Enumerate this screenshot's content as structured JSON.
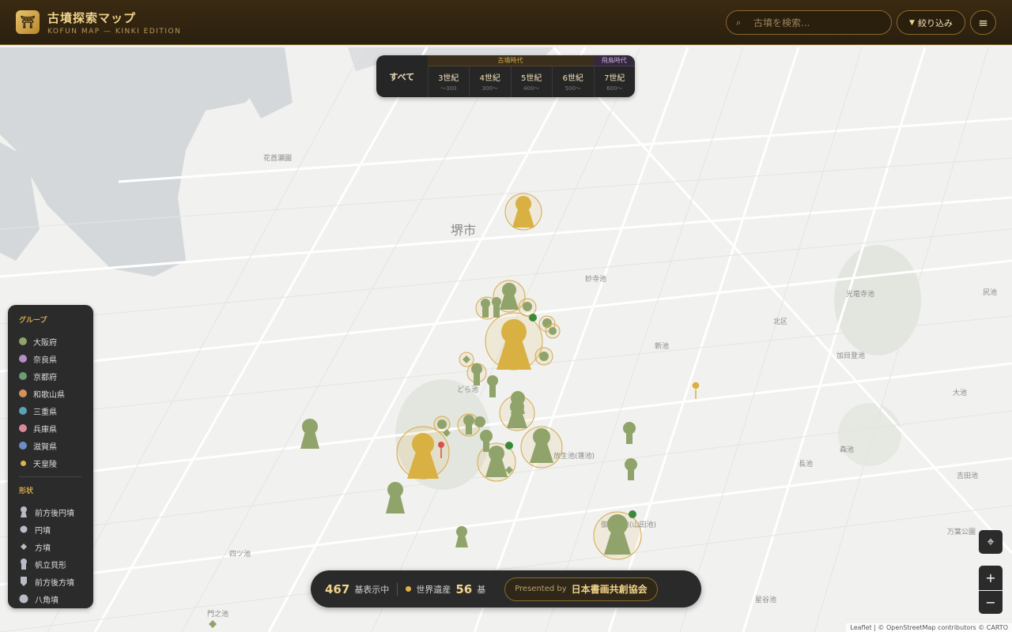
{
  "header": {
    "logo_glyph": "⛩",
    "title": "古墳探索マップ",
    "subtitle": "KOFUN MAP — KINKI EDITION",
    "search_placeholder": "古墳を検索...",
    "filter_label": "絞り込み",
    "menu_icon": "hamburger-icon"
  },
  "era": {
    "all_label": "すべて",
    "kofun_heading": "古墳時代",
    "asuka_heading": "飛鳥時代",
    "periods": [
      {
        "label": "3世紀",
        "range": "〜300"
      },
      {
        "label": "4世紀",
        "range": "300〜"
      },
      {
        "label": "5世紀",
        "range": "400〜"
      },
      {
        "label": "6世紀",
        "range": "500〜"
      },
      {
        "label": "7世紀",
        "range": "600〜"
      }
    ]
  },
  "legend": {
    "group_title": "グループ",
    "groups": [
      {
        "label": "大阪府",
        "color": "#8fa36a"
      },
      {
        "label": "奈良県",
        "color": "#b48fc4"
      },
      {
        "label": "京都府",
        "color": "#6a9e72"
      },
      {
        "label": "和歌山県",
        "color": "#d4925a"
      },
      {
        "label": "三重県",
        "color": "#5aa0b8"
      },
      {
        "label": "兵庫県",
        "color": "#d88a9a"
      },
      {
        "label": "滋賀県",
        "color": "#6a8fc4"
      },
      {
        "label": "天皇陵",
        "color": "#e0b248"
      }
    ],
    "shape_title": "形状",
    "shapes": [
      {
        "label": "前方後円墳",
        "icon": "keyhole-icon"
      },
      {
        "label": "円墳",
        "icon": "circle-icon"
      },
      {
        "label": "方墳",
        "icon": "diamond-icon"
      },
      {
        "label": "帆立貝形",
        "icon": "scallop-icon"
      },
      {
        "label": "前方後方墳",
        "icon": "shield-icon"
      },
      {
        "label": "八角墳",
        "icon": "octagon-icon"
      }
    ]
  },
  "stats": {
    "count": "467",
    "count_label": "基表示中",
    "world_heritage_label": "世界遺産",
    "world_heritage_count": "56",
    "world_heritage_unit": "基",
    "presented_label": "Presented by",
    "presented_org": "日本書画共創協会"
  },
  "map": {
    "city_label": "堺市",
    "labels": [
      "花首瀬園",
      "妙寺池",
      "北区",
      "新池",
      "加目登池",
      "光竜寺池",
      "どら池",
      "放生池(蓮池)",
      "長池",
      "森池",
      "吉田池",
      "御廟山池(山田池)",
      "四ツ池",
      "門之池",
      "大池",
      "尻池",
      "星谷池",
      "万葉公園"
    ],
    "attribution": "Leaflet | © OpenStreetMap contributors © CARTO"
  },
  "controls": {
    "locate_icon": "crosshair-icon",
    "zoom_in": "+",
    "zoom_out": "−"
  },
  "colors": {
    "osaka": "#8fa36a",
    "emperor": "#e0b248",
    "header_bg": "#2a1f0f",
    "accent": "#f0d38a"
  }
}
